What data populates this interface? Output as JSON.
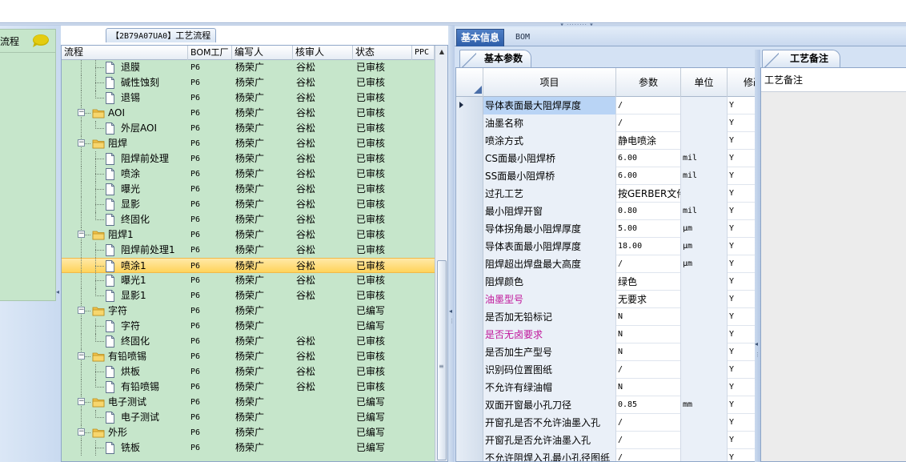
{
  "left_panel": {
    "header_label": "流程"
  },
  "tree": {
    "title_code": "【2B79A07UA0】",
    "title_text": "工艺流程",
    "columns": {
      "flow": "流程",
      "bom": "BOM工厂",
      "writer": "编写人",
      "reviewer": "核审人",
      "status": "状态",
      "ppc": "PPC"
    },
    "rows": [
      {
        "label": "退膜",
        "type": "leaf",
        "level": 1,
        "last": false,
        "bom": "P6",
        "writer": "杨荣广",
        "reviewer": "谷松",
        "status": "已审核"
      },
      {
        "label": "碱性蚀刻",
        "type": "leaf",
        "level": 1,
        "last": false,
        "bom": "P6",
        "writer": "杨荣广",
        "reviewer": "谷松",
        "status": "已审核"
      },
      {
        "label": "退锡",
        "type": "leaf",
        "level": 1,
        "last": true,
        "bom": "P6",
        "writer": "杨荣广",
        "reviewer": "谷松",
        "status": "已审核"
      },
      {
        "label": "AOI",
        "type": "folder",
        "level": 0,
        "last": false,
        "bom": "P6",
        "writer": "杨荣广",
        "reviewer": "谷松",
        "status": "已审核"
      },
      {
        "label": "外层AOI",
        "type": "leaf",
        "level": 1,
        "last": true,
        "bom": "P6",
        "writer": "杨荣广",
        "reviewer": "谷松",
        "status": "已审核"
      },
      {
        "label": "阻焊",
        "type": "folder",
        "level": 0,
        "last": false,
        "bom": "P6",
        "writer": "杨荣广",
        "reviewer": "谷松",
        "status": "已审核"
      },
      {
        "label": "阻焊前处理",
        "type": "leaf",
        "level": 1,
        "last": false,
        "bom": "P6",
        "writer": "杨荣广",
        "reviewer": "谷松",
        "status": "已审核"
      },
      {
        "label": "喷涂",
        "type": "leaf",
        "level": 1,
        "last": false,
        "bom": "P6",
        "writer": "杨荣广",
        "reviewer": "谷松",
        "status": "已审核"
      },
      {
        "label": "曝光",
        "type": "leaf",
        "level": 1,
        "last": false,
        "bom": "P6",
        "writer": "杨荣广",
        "reviewer": "谷松",
        "status": "已审核"
      },
      {
        "label": "显影",
        "type": "leaf",
        "level": 1,
        "last": false,
        "bom": "P6",
        "writer": "杨荣广",
        "reviewer": "谷松",
        "status": "已审核"
      },
      {
        "label": "终固化",
        "type": "leaf",
        "level": 1,
        "last": true,
        "bom": "P6",
        "writer": "杨荣广",
        "reviewer": "谷松",
        "status": "已审核"
      },
      {
        "label": "阻焊1",
        "type": "folder",
        "level": 0,
        "last": false,
        "bom": "P6",
        "writer": "杨荣广",
        "reviewer": "谷松",
        "status": "已审核"
      },
      {
        "label": "阻焊前处理1",
        "type": "leaf",
        "level": 1,
        "last": false,
        "bom": "P6",
        "writer": "杨荣广",
        "reviewer": "谷松",
        "status": "已审核"
      },
      {
        "label": "喷涂1",
        "type": "leaf",
        "level": 1,
        "last": false,
        "selected": true,
        "bom": "P6",
        "writer": "杨荣广",
        "reviewer": "谷松",
        "status": "已审核"
      },
      {
        "label": "曝光1",
        "type": "leaf",
        "level": 1,
        "last": false,
        "bom": "P6",
        "writer": "杨荣广",
        "reviewer": "谷松",
        "status": "已审核"
      },
      {
        "label": "显影1",
        "type": "leaf",
        "level": 1,
        "last": true,
        "bom": "P6",
        "writer": "杨荣广",
        "reviewer": "谷松",
        "status": "已审核"
      },
      {
        "label": "字符",
        "type": "folder",
        "level": 0,
        "last": false,
        "bom": "P6",
        "writer": "杨荣广",
        "reviewer": "",
        "status": "已编写"
      },
      {
        "label": "字符",
        "type": "leaf",
        "level": 1,
        "last": false,
        "bom": "P6",
        "writer": "杨荣广",
        "reviewer": "",
        "status": "已编写"
      },
      {
        "label": "终固化",
        "type": "leaf",
        "level": 1,
        "last": true,
        "bom": "P6",
        "writer": "杨荣广",
        "reviewer": "谷松",
        "status": "已审核"
      },
      {
        "label": "有铅喷锡",
        "type": "folder",
        "level": 0,
        "last": false,
        "bom": "P6",
        "writer": "杨荣广",
        "reviewer": "谷松",
        "status": "已审核"
      },
      {
        "label": "烘板",
        "type": "leaf",
        "level": 1,
        "last": false,
        "bom": "P6",
        "writer": "杨荣广",
        "reviewer": "谷松",
        "status": "已审核"
      },
      {
        "label": "有铅喷锡",
        "type": "leaf",
        "level": 1,
        "last": true,
        "bom": "P6",
        "writer": "杨荣广",
        "reviewer": "谷松",
        "status": "已审核"
      },
      {
        "label": "电子测试",
        "type": "folder",
        "level": 0,
        "last": false,
        "bom": "P6",
        "writer": "杨荣广",
        "reviewer": "",
        "status": "已编写"
      },
      {
        "label": "电子测试",
        "type": "leaf",
        "level": 1,
        "last": true,
        "bom": "P6",
        "writer": "杨荣广",
        "reviewer": "",
        "status": "已编写"
      },
      {
        "label": "外形",
        "type": "folder",
        "level": 0,
        "last": false,
        "bom": "P6",
        "writer": "杨荣广",
        "reviewer": "",
        "status": "已编写"
      },
      {
        "label": "铣板",
        "type": "leaf",
        "level": 1,
        "last": false,
        "bom": "P6",
        "writer": "杨荣广",
        "reviewer": "",
        "status": "已编写"
      }
    ]
  },
  "tabs": {
    "basic_info": "基本信息",
    "bom": "BOM"
  },
  "params": {
    "subtab_label": "基本参数",
    "columns": {
      "item": "项目",
      "value": "参数",
      "unit": "单位",
      "modify": "修改"
    },
    "rows": [
      {
        "item": "导体表面最大阻焊厚度",
        "value": "/",
        "unit": "",
        "modify": "Y",
        "current": true
      },
      {
        "item": "油墨名称",
        "value": "/",
        "unit": "",
        "modify": "Y"
      },
      {
        "item": "喷涂方式",
        "value": "静电喷涂",
        "unit": "",
        "modify": "Y"
      },
      {
        "item": "CS面最小阻焊桥",
        "value": "6.00",
        "unit": "mil",
        "modify": "Y"
      },
      {
        "item": "SS面最小阻焊桥",
        "value": "6.00",
        "unit": "mil",
        "modify": "Y"
      },
      {
        "item": "过孔工艺",
        "value": "按GERBER文件",
        "unit": "",
        "modify": "Y"
      },
      {
        "item": "最小阻焊开窗",
        "value": "0.80",
        "unit": "mil",
        "modify": "Y"
      },
      {
        "item": "导体拐角最小阻焊厚度",
        "value": "5.00",
        "unit": "μm",
        "modify": "Y"
      },
      {
        "item": "导体表面最小阻焊厚度",
        "value": "18.00",
        "unit": "μm",
        "modify": "Y"
      },
      {
        "item": "阻焊超出焊盘最大高度",
        "value": "/",
        "unit": "μm",
        "modify": "Y"
      },
      {
        "item": "阻焊颜色",
        "value": "绿色",
        "unit": "",
        "modify": "Y"
      },
      {
        "item": "油墨型号",
        "value": "无要求",
        "unit": "",
        "modify": "Y",
        "flag": true
      },
      {
        "item": "是否加无铅标记",
        "value": "N",
        "unit": "",
        "modify": "Y"
      },
      {
        "item": "是否无卤要求",
        "value": "N",
        "unit": "",
        "modify": "Y",
        "flag": true
      },
      {
        "item": "是否加生产型号",
        "value": "N",
        "unit": "",
        "modify": "Y"
      },
      {
        "item": "识别码位置图纸",
        "value": "/",
        "unit": "",
        "modify": "Y"
      },
      {
        "item": "不允许有绿油帽",
        "value": "N",
        "unit": "",
        "modify": "Y"
      },
      {
        "item": "双面开窗最小孔刀径",
        "value": "0.85",
        "unit": "mm",
        "modify": "Y"
      },
      {
        "item": "开窗孔是否不允许油墨入孔",
        "value": "/",
        "unit": "",
        "modify": "Y"
      },
      {
        "item": "开窗孔是否允许油墨入孔",
        "value": "/",
        "unit": "",
        "modify": "Y"
      },
      {
        "item": "不允许阻焊入孔最小孔径图纸",
        "value": "/",
        "unit": "",
        "modify": "Y"
      }
    ]
  },
  "notes": {
    "tab_label": "工艺备注",
    "field_label": "工艺备注"
  },
  "colors": {
    "tree_bg": "#c6e6cb",
    "selected_row": "#ffd35a",
    "tab_active": "#2e5ea8",
    "flag_text": "#c0169a"
  }
}
